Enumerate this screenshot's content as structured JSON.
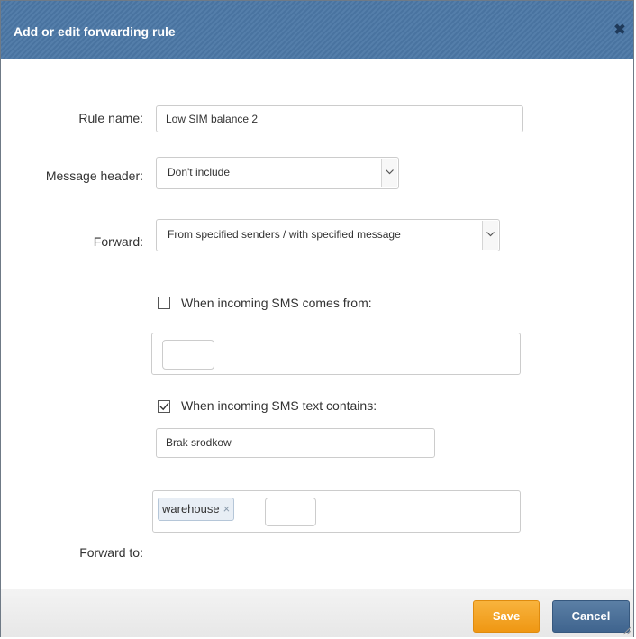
{
  "dialog": {
    "title": "Add or edit forwarding rule",
    "close_icon": "close-icon"
  },
  "form": {
    "rule_name_label": "Rule name:",
    "rule_name_value": "Low SIM balance 2",
    "message_header_label": "Message header:",
    "message_header_value": "Don't include",
    "forward_label": "Forward:",
    "forward_value": "From specified senders / with specified message",
    "from_checkbox_label": "When incoming SMS comes from:",
    "from_checkbox_checked": false,
    "text_checkbox_label": "When incoming SMS text contains:",
    "text_checkbox_checked": true,
    "text_contains_value": "Brak srodkow",
    "forward_to_label": "Forward to:",
    "forward_to_tags": [
      "warehouse"
    ]
  },
  "footer": {
    "save_label": "Save",
    "cancel_label": "Cancel"
  },
  "colors": {
    "titlebar": "#4b77a5",
    "save": "#f5a623",
    "cancel": "#4a6f98"
  }
}
